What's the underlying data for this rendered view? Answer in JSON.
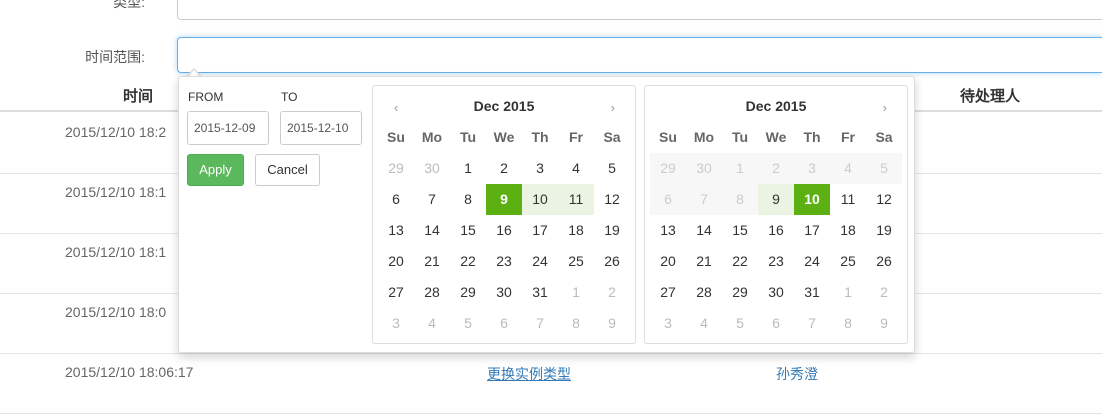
{
  "form": {
    "type_label": "类型:",
    "time_range_label": "时间范围:"
  },
  "table": {
    "headers": {
      "time": "时间",
      "handler": "待处理人"
    },
    "rows": [
      {
        "time": "2015/12/10 18:2"
      },
      {
        "time": "2015/12/10 18:1"
      },
      {
        "time": "2015/12/10 18:1"
      },
      {
        "time": "2015/12/10 18:0"
      },
      {
        "time": "2015/12/10 18:06:17",
        "operation": "更换实例类型",
        "handler": "孙秀澄"
      }
    ]
  },
  "picker": {
    "from_label": "FROM",
    "to_label": "TO",
    "from_value": "2015-12-09",
    "to_value": "2015-12-10",
    "apply_label": "Apply",
    "cancel_label": "Cancel",
    "prev_icon": "‹",
    "next_icon": "›",
    "weekdays": [
      "Su",
      "Mo",
      "Tu",
      "We",
      "Th",
      "Fr",
      "Sa"
    ],
    "calendars": [
      {
        "title": "Dec 2015",
        "has_prev": true,
        "has_next": true,
        "weeks": [
          [
            {
              "d": "29",
              "s": "muted"
            },
            {
              "d": "30",
              "s": "muted"
            },
            {
              "d": "1"
            },
            {
              "d": "2"
            },
            {
              "d": "3"
            },
            {
              "d": "4"
            },
            {
              "d": "5"
            }
          ],
          [
            {
              "d": "6"
            },
            {
              "d": "7"
            },
            {
              "d": "8"
            },
            {
              "d": "9",
              "s": "active"
            },
            {
              "d": "10",
              "s": "inrange"
            },
            {
              "d": "11",
              "s": "inrange"
            },
            {
              "d": "12"
            }
          ],
          [
            {
              "d": "13"
            },
            {
              "d": "14"
            },
            {
              "d": "15"
            },
            {
              "d": "16"
            },
            {
              "d": "17"
            },
            {
              "d": "18"
            },
            {
              "d": "19"
            }
          ],
          [
            {
              "d": "20"
            },
            {
              "d": "21"
            },
            {
              "d": "22"
            },
            {
              "d": "23"
            },
            {
              "d": "24"
            },
            {
              "d": "25"
            },
            {
              "d": "26"
            }
          ],
          [
            {
              "d": "27"
            },
            {
              "d": "28"
            },
            {
              "d": "29"
            },
            {
              "d": "30"
            },
            {
              "d": "31"
            },
            {
              "d": "1",
              "s": "muted"
            },
            {
              "d": "2",
              "s": "muted"
            }
          ],
          [
            {
              "d": "3",
              "s": "muted"
            },
            {
              "d": "4",
              "s": "muted"
            },
            {
              "d": "5",
              "s": "muted"
            },
            {
              "d": "6",
              "s": "muted"
            },
            {
              "d": "7",
              "s": "muted"
            },
            {
              "d": "8",
              "s": "muted"
            },
            {
              "d": "9",
              "s": "muted"
            }
          ]
        ]
      },
      {
        "title": "Dec 2015",
        "has_prev": false,
        "has_next": true,
        "weeks": [
          [
            {
              "d": "29",
              "s": "disabled"
            },
            {
              "d": "30",
              "s": "disabled"
            },
            {
              "d": "1",
              "s": "disabled"
            },
            {
              "d": "2",
              "s": "disabled"
            },
            {
              "d": "3",
              "s": "disabled"
            },
            {
              "d": "4",
              "s": "disabled"
            },
            {
              "d": "5",
              "s": "disabled"
            }
          ],
          [
            {
              "d": "6",
              "s": "disabled"
            },
            {
              "d": "7",
              "s": "disabled"
            },
            {
              "d": "8",
              "s": "disabled"
            },
            {
              "d": "9",
              "s": "inrange"
            },
            {
              "d": "10",
              "s": "active"
            },
            {
              "d": "11"
            },
            {
              "d": "12"
            }
          ],
          [
            {
              "d": "13"
            },
            {
              "d": "14"
            },
            {
              "d": "15"
            },
            {
              "d": "16"
            },
            {
              "d": "17"
            },
            {
              "d": "18"
            },
            {
              "d": "19"
            }
          ],
          [
            {
              "d": "20"
            },
            {
              "d": "21"
            },
            {
              "d": "22"
            },
            {
              "d": "23"
            },
            {
              "d": "24"
            },
            {
              "d": "25"
            },
            {
              "d": "26"
            }
          ],
          [
            {
              "d": "27"
            },
            {
              "d": "28"
            },
            {
              "d": "29"
            },
            {
              "d": "30"
            },
            {
              "d": "31"
            },
            {
              "d": "1",
              "s": "muted"
            },
            {
              "d": "2",
              "s": "muted"
            }
          ],
          [
            {
              "d": "3",
              "s": "muted"
            },
            {
              "d": "4",
              "s": "muted"
            },
            {
              "d": "5",
              "s": "muted"
            },
            {
              "d": "6",
              "s": "muted"
            },
            {
              "d": "7",
              "s": "muted"
            },
            {
              "d": "8",
              "s": "muted"
            },
            {
              "d": "9",
              "s": "muted"
            }
          ]
        ]
      }
    ]
  },
  "colors": {
    "accent_green": "#5cb012",
    "range_fill": "#ebf4e3",
    "apply_button": "#5cb85c",
    "link_blue": "#337ab7"
  }
}
